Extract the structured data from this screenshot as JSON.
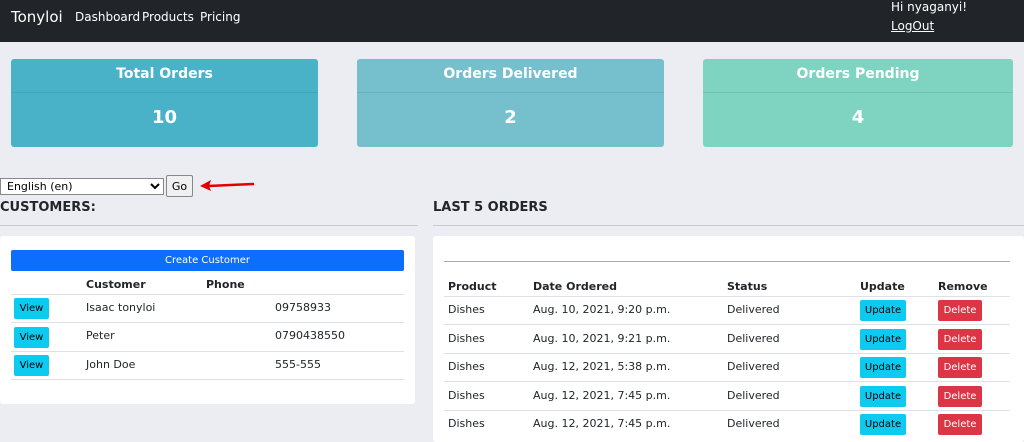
{
  "navbar": {
    "brand": "Tonyloi",
    "links": [
      "Dashboard",
      "Products",
      "Pricing"
    ],
    "greeting": "Hi nyaganyi!",
    "logout": "LogOut"
  },
  "stats": [
    {
      "label": "Total Orders",
      "value": "10",
      "color": "#4ab2c8"
    },
    {
      "label": "Orders Delivered",
      "value": "2",
      "color": "#76bfcd"
    },
    {
      "label": "Orders Pending",
      "value": "4",
      "color": "#7ed4c1"
    }
  ],
  "language": {
    "selected": "English (en)",
    "go_label": "Go"
  },
  "customers": {
    "title": "CUSTOMERS:",
    "create_label": "Create Customer",
    "headers": [
      "Customer",
      "Phone"
    ],
    "view_label": "View",
    "rows": [
      {
        "name": "Isaac tonyloi",
        "phone": "09758933"
      },
      {
        "name": "Peter",
        "phone": "0790438550"
      },
      {
        "name": "John Doe",
        "phone": "555-555"
      }
    ]
  },
  "orders": {
    "title": "LAST 5 ORDERS",
    "headers": [
      "Product",
      "Date Ordered",
      "Status",
      "Update",
      "Remove"
    ],
    "update_label": "Update",
    "delete_label": "Delete",
    "rows": [
      {
        "product": "Dishes",
        "date": "Aug. 10, 2021, 9:20 p.m.",
        "status": "Delivered"
      },
      {
        "product": "Dishes",
        "date": "Aug. 10, 2021, 9:21 p.m.",
        "status": "Delivered"
      },
      {
        "product": "Dishes",
        "date": "Aug. 12, 2021, 5:38 p.m.",
        "status": "Delivered"
      },
      {
        "product": "Dishes",
        "date": "Aug. 12, 2021, 7:45 p.m.",
        "status": "Delivered"
      },
      {
        "product": "Dishes",
        "date": "Aug. 12, 2021, 7:45 p.m.",
        "status": "Delivered"
      }
    ]
  },
  "annotation": {
    "icon": "red-arrow-icon",
    "color": "#e00000"
  }
}
